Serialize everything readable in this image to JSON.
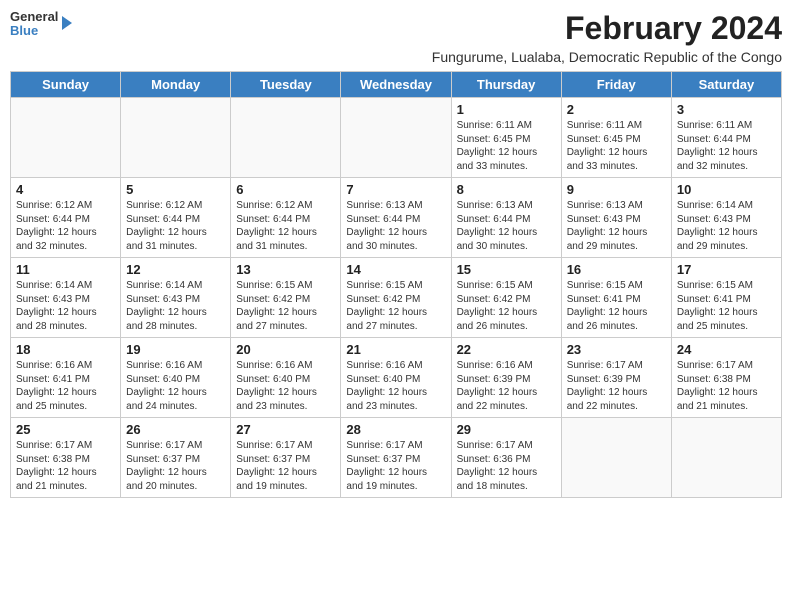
{
  "header": {
    "logo_general": "General",
    "logo_blue": "Blue",
    "month_year": "February 2024",
    "location": "Fungurume, Lualaba, Democratic Republic of the Congo"
  },
  "days_of_week": [
    "Sunday",
    "Monday",
    "Tuesday",
    "Wednesday",
    "Thursday",
    "Friday",
    "Saturday"
  ],
  "weeks": [
    [
      {
        "day": "",
        "info": ""
      },
      {
        "day": "",
        "info": ""
      },
      {
        "day": "",
        "info": ""
      },
      {
        "day": "",
        "info": ""
      },
      {
        "day": "1",
        "info": "Sunrise: 6:11 AM\nSunset: 6:45 PM\nDaylight: 12 hours and 33 minutes."
      },
      {
        "day": "2",
        "info": "Sunrise: 6:11 AM\nSunset: 6:45 PM\nDaylight: 12 hours and 33 minutes."
      },
      {
        "day": "3",
        "info": "Sunrise: 6:11 AM\nSunset: 6:44 PM\nDaylight: 12 hours and 32 minutes."
      }
    ],
    [
      {
        "day": "4",
        "info": "Sunrise: 6:12 AM\nSunset: 6:44 PM\nDaylight: 12 hours and 32 minutes."
      },
      {
        "day": "5",
        "info": "Sunrise: 6:12 AM\nSunset: 6:44 PM\nDaylight: 12 hours and 31 minutes."
      },
      {
        "day": "6",
        "info": "Sunrise: 6:12 AM\nSunset: 6:44 PM\nDaylight: 12 hours and 31 minutes."
      },
      {
        "day": "7",
        "info": "Sunrise: 6:13 AM\nSunset: 6:44 PM\nDaylight: 12 hours and 30 minutes."
      },
      {
        "day": "8",
        "info": "Sunrise: 6:13 AM\nSunset: 6:44 PM\nDaylight: 12 hours and 30 minutes."
      },
      {
        "day": "9",
        "info": "Sunrise: 6:13 AM\nSunset: 6:43 PM\nDaylight: 12 hours and 29 minutes."
      },
      {
        "day": "10",
        "info": "Sunrise: 6:14 AM\nSunset: 6:43 PM\nDaylight: 12 hours and 29 minutes."
      }
    ],
    [
      {
        "day": "11",
        "info": "Sunrise: 6:14 AM\nSunset: 6:43 PM\nDaylight: 12 hours and 28 minutes."
      },
      {
        "day": "12",
        "info": "Sunrise: 6:14 AM\nSunset: 6:43 PM\nDaylight: 12 hours and 28 minutes."
      },
      {
        "day": "13",
        "info": "Sunrise: 6:15 AM\nSunset: 6:42 PM\nDaylight: 12 hours and 27 minutes."
      },
      {
        "day": "14",
        "info": "Sunrise: 6:15 AM\nSunset: 6:42 PM\nDaylight: 12 hours and 27 minutes."
      },
      {
        "day": "15",
        "info": "Sunrise: 6:15 AM\nSunset: 6:42 PM\nDaylight: 12 hours and 26 minutes."
      },
      {
        "day": "16",
        "info": "Sunrise: 6:15 AM\nSunset: 6:41 PM\nDaylight: 12 hours and 26 minutes."
      },
      {
        "day": "17",
        "info": "Sunrise: 6:15 AM\nSunset: 6:41 PM\nDaylight: 12 hours and 25 minutes."
      }
    ],
    [
      {
        "day": "18",
        "info": "Sunrise: 6:16 AM\nSunset: 6:41 PM\nDaylight: 12 hours and 25 minutes."
      },
      {
        "day": "19",
        "info": "Sunrise: 6:16 AM\nSunset: 6:40 PM\nDaylight: 12 hours and 24 minutes."
      },
      {
        "day": "20",
        "info": "Sunrise: 6:16 AM\nSunset: 6:40 PM\nDaylight: 12 hours and 23 minutes."
      },
      {
        "day": "21",
        "info": "Sunrise: 6:16 AM\nSunset: 6:40 PM\nDaylight: 12 hours and 23 minutes."
      },
      {
        "day": "22",
        "info": "Sunrise: 6:16 AM\nSunset: 6:39 PM\nDaylight: 12 hours and 22 minutes."
      },
      {
        "day": "23",
        "info": "Sunrise: 6:17 AM\nSunset: 6:39 PM\nDaylight: 12 hours and 22 minutes."
      },
      {
        "day": "24",
        "info": "Sunrise: 6:17 AM\nSunset: 6:38 PM\nDaylight: 12 hours and 21 minutes."
      }
    ],
    [
      {
        "day": "25",
        "info": "Sunrise: 6:17 AM\nSunset: 6:38 PM\nDaylight: 12 hours and 21 minutes."
      },
      {
        "day": "26",
        "info": "Sunrise: 6:17 AM\nSunset: 6:37 PM\nDaylight: 12 hours and 20 minutes."
      },
      {
        "day": "27",
        "info": "Sunrise: 6:17 AM\nSunset: 6:37 PM\nDaylight: 12 hours and 19 minutes."
      },
      {
        "day": "28",
        "info": "Sunrise: 6:17 AM\nSunset: 6:37 PM\nDaylight: 12 hours and 19 minutes."
      },
      {
        "day": "29",
        "info": "Sunrise: 6:17 AM\nSunset: 6:36 PM\nDaylight: 12 hours and 18 minutes."
      },
      {
        "day": "",
        "info": ""
      },
      {
        "day": "",
        "info": ""
      }
    ]
  ]
}
